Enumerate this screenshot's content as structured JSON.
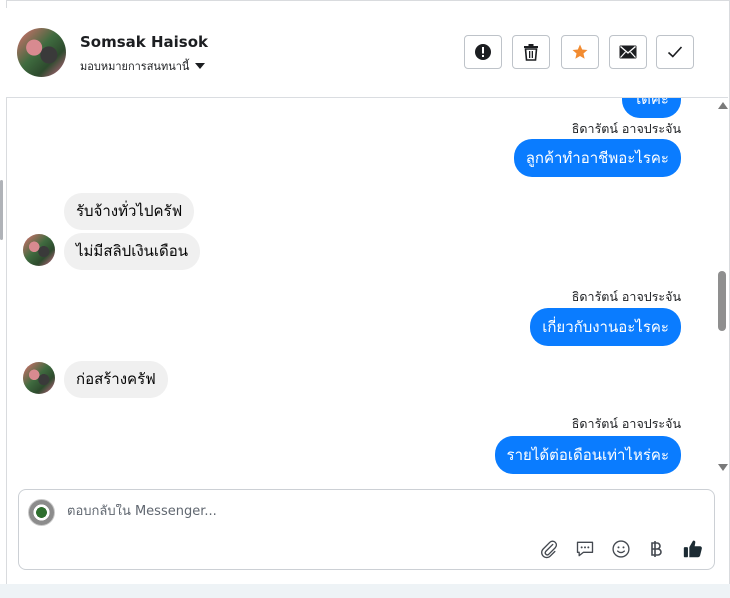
{
  "header": {
    "name": "Somsak Haisok",
    "assign_label": "มอบหมายการสนทนานี้"
  },
  "toolbar": {
    "icons": [
      "alert-icon",
      "trash-icon",
      "star-icon",
      "mail-icon",
      "check-icon"
    ],
    "star_color": "#f28b30"
  },
  "messages": {
    "partial_top": "ได้คะ",
    "sender_name": "ธิดารัตน์ อาจประจัน",
    "m1": "ลูกค้าทำอาชีพอะไรคะ",
    "m2": "รับจ้างทั่วไปครัฟ",
    "m3": "ไม่มีสลิปเงินเดือน",
    "m4": "เกี่ยวกับงานอะไรคะ",
    "m5": "ก่อสร้างครัฟ",
    "m6": "รายได้ต่อเดือนเท่าไหร่คะ"
  },
  "composer": {
    "placeholder": "ตอบกลับใน Messenger..."
  },
  "colors": {
    "outgoing_bubble": "#0a7cff",
    "incoming_bubble": "#f0f0f0"
  }
}
